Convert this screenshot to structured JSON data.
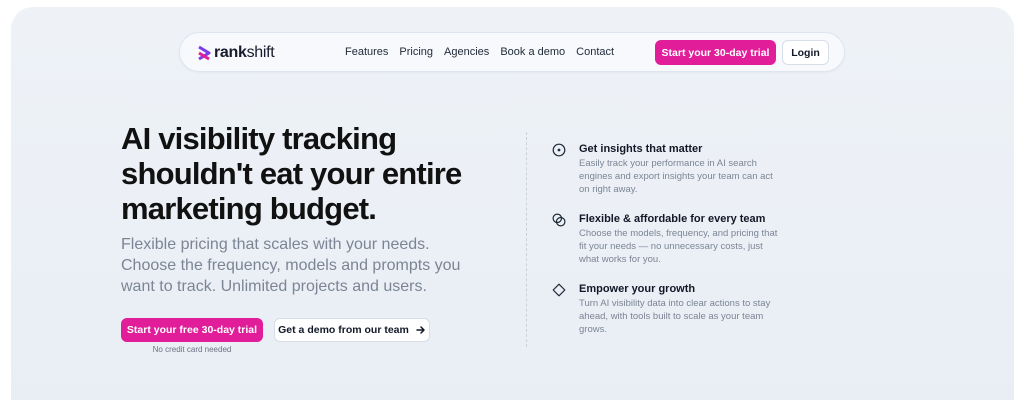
{
  "brand": {
    "name_bold": "rank",
    "name_rest": "shift",
    "accent": "#e11d99"
  },
  "nav": {
    "links": [
      "Features",
      "Pricing",
      "Agencies",
      "Book a demo",
      "Contact"
    ],
    "trial_label": "Start your 30-day trial",
    "login_label": "Login"
  },
  "hero": {
    "headline_lines": [
      "AI visibility tracking",
      "shouldn't eat your entire",
      "marketing budget."
    ],
    "subtext_lines": [
      "Flexible pricing that scales with your needs.",
      "Choose the frequency, models and prompts you",
      "want to track. Unlimited projects and users."
    ],
    "cta_primary": "Start your free 30-day trial",
    "cta_note": "No credit card needed",
    "cta_secondary": "Get a demo from our team"
  },
  "features": [
    {
      "icon": "target-icon",
      "title": "Get insights that matter",
      "desc": "Easily track your performance in AI search engines and export insights your team can act on right away."
    },
    {
      "icon": "overlap-circles-icon",
      "title": "Flexible & affordable for every team",
      "desc": "Choose the models, frequency, and pricing that fit your needs — no unnecessary costs, just what works for you."
    },
    {
      "icon": "diamond-icon",
      "title": "Empower your growth",
      "desc": "Turn AI visibility data into clear actions to stay ahead, with tools built to scale as your team grows."
    }
  ]
}
